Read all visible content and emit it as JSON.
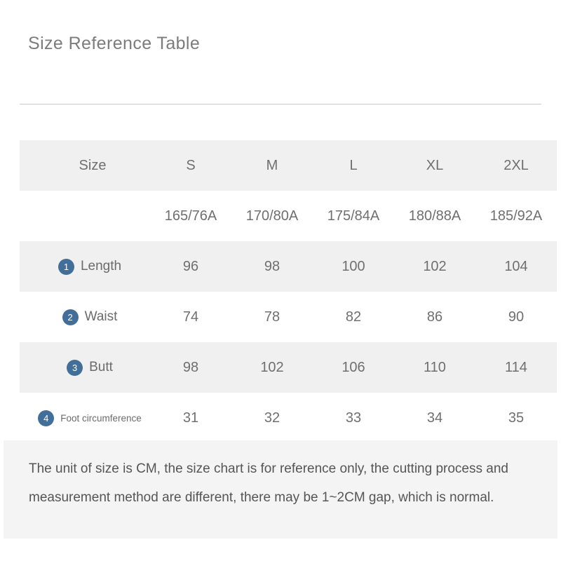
{
  "title": "Size Reference Table",
  "table": {
    "header": {
      "label": "Size",
      "sizes": [
        "S",
        "M",
        "L",
        "XL",
        "2XL"
      ]
    },
    "spec_row": {
      "label": "",
      "values": [
        "165/76A",
        "170/80A",
        "175/84A",
        "180/88A",
        "185/92A"
      ]
    },
    "rows": [
      {
        "badge": "1",
        "label": "Length",
        "values": [
          "96",
          "98",
          "100",
          "102",
          "104"
        ]
      },
      {
        "badge": "2",
        "label": "Waist",
        "values": [
          "74",
          "78",
          "82",
          "86",
          "90"
        ]
      },
      {
        "badge": "3",
        "label": "Butt",
        "values": [
          "98",
          "102",
          "106",
          "110",
          "114"
        ]
      },
      {
        "badge": "4",
        "label": "Foot circumference",
        "values": [
          "31",
          "32",
          "33",
          "34",
          "35"
        ]
      }
    ]
  },
  "footer": {
    "note": "The unit of size is CM, the size chart is for reference only, the cutting process and measurement method are different, there may be 1~2CM gap, which is normal."
  },
  "colors": {
    "badge_blue": "#416f99",
    "row_shade": "#f0f0f0",
    "text_grey": "#6f6f6f",
    "footer_bg": "#f4f4f4"
  }
}
